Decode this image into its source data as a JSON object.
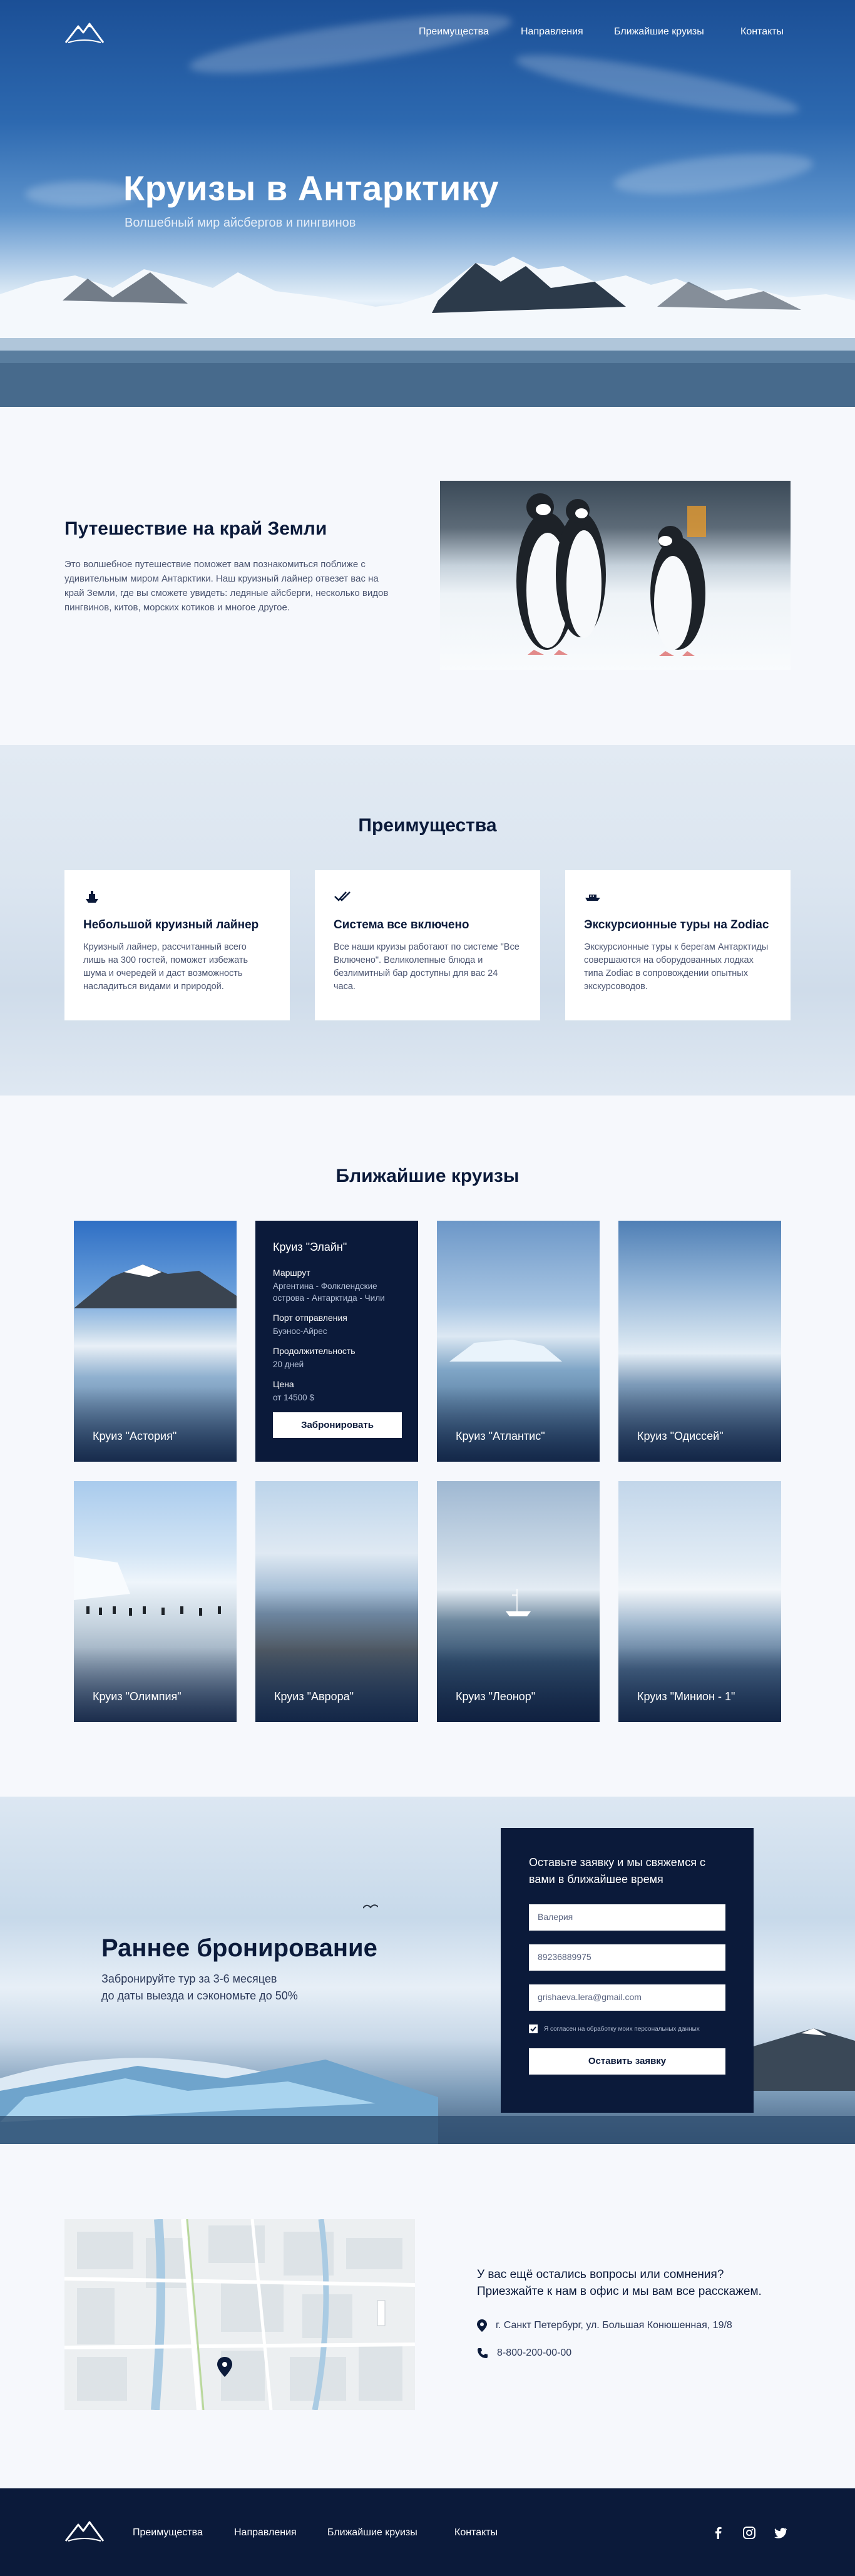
{
  "nav": {
    "items": [
      "Преимущества",
      "Направления",
      "Ближайшие круизы",
      "Контакты"
    ]
  },
  "hero": {
    "title": "Круизы в Антарктику",
    "subtitle": "Волшебный мир айсбергов и пингвинов"
  },
  "intro": {
    "title": "Путешествие на край Земли",
    "text": "Это волшебное путешествие поможет вам познакомиться поближе с удивительным миром Антарктики. Наш круизный лайнер отвезет вас на край Земли, где вы сможете увидеть: ледяные айсберги, несколько видов пингвинов, китов, морских котиков и многое другое."
  },
  "advantages": {
    "title": "Преимущества",
    "cards": [
      {
        "icon": "ship-icon",
        "title": "Небольшой круизный лайнер",
        "text": "Круизный лайнер, рассчитанный всего лишь на 300 гостей, поможет избежать шума и очередей и даст возможность насладиться видами и природой."
      },
      {
        "icon": "double-check-icon",
        "title": "Система все включено",
        "text": "Все наши круизы работают по системе \"Все Включено\". Великолепные блюда и безлимитный бар доступны для вас 24 часа."
      },
      {
        "icon": "boat-icon",
        "title": "Экскурсионные туры на Zodiac",
        "text": "Экскурсионные туры к берегам Антарктиды совершаются на оборудованных лодках типа Zodiac в сопровождении опытных экскурсоводов."
      }
    ]
  },
  "cruises": {
    "title": "Ближайшие круизы",
    "tiles": [
      {
        "name": "Круиз \"Астория\""
      },
      {
        "name": "Круиз \"Атлантис\""
      },
      {
        "name": "Круиз \"Одиссей\""
      },
      {
        "name": "Круиз \"Олимпия\""
      },
      {
        "name": "Круиз \"Аврора\""
      },
      {
        "name": "Круиз \"Леонор\""
      },
      {
        "name": "Круиз \"Минион - 1\""
      }
    ],
    "featured": {
      "title": "Круиз \"Элайн\"",
      "route_label": "Маршрут",
      "route": "Аргентина - Фолклендские острова - Антарктида - Чили",
      "port_label": "Порт отправления",
      "port": "Буэнос-Айрес",
      "duration_label": "Продолжительность",
      "duration": "20 дней",
      "price_label": "Цена",
      "price": "от 14500 $",
      "button": "Забронировать"
    }
  },
  "early": {
    "title": "Раннее бронирование",
    "subtitle_line1": "Забронируйте тур за 3-6 месяцев",
    "subtitle_line2": "до даты выезда и сэкономьте до 50%",
    "form": {
      "title": "Оставьте заявку и мы свяжемся с вами в ближайшее время",
      "name": "Валерия",
      "phone": "89236889975",
      "email": "grishaeva.lera@gmail.com",
      "consent": "Я согласен на обработку моих персональных данных",
      "submit": "Оставить заявку"
    }
  },
  "contact": {
    "question_line1": "У вас ещё остались вопросы или сомнения?",
    "question_line2": "Приезжайте к нам в офис и мы вам все расскажем.",
    "address": "г. Санкт Петербург, ул. Большая Конюшенная, 19/8",
    "phone": "8-800-200-00-00"
  },
  "colors": {
    "navy": "#0b1a3a",
    "page_bg": "#f6f8fc",
    "text_muted": "#4a5470"
  }
}
